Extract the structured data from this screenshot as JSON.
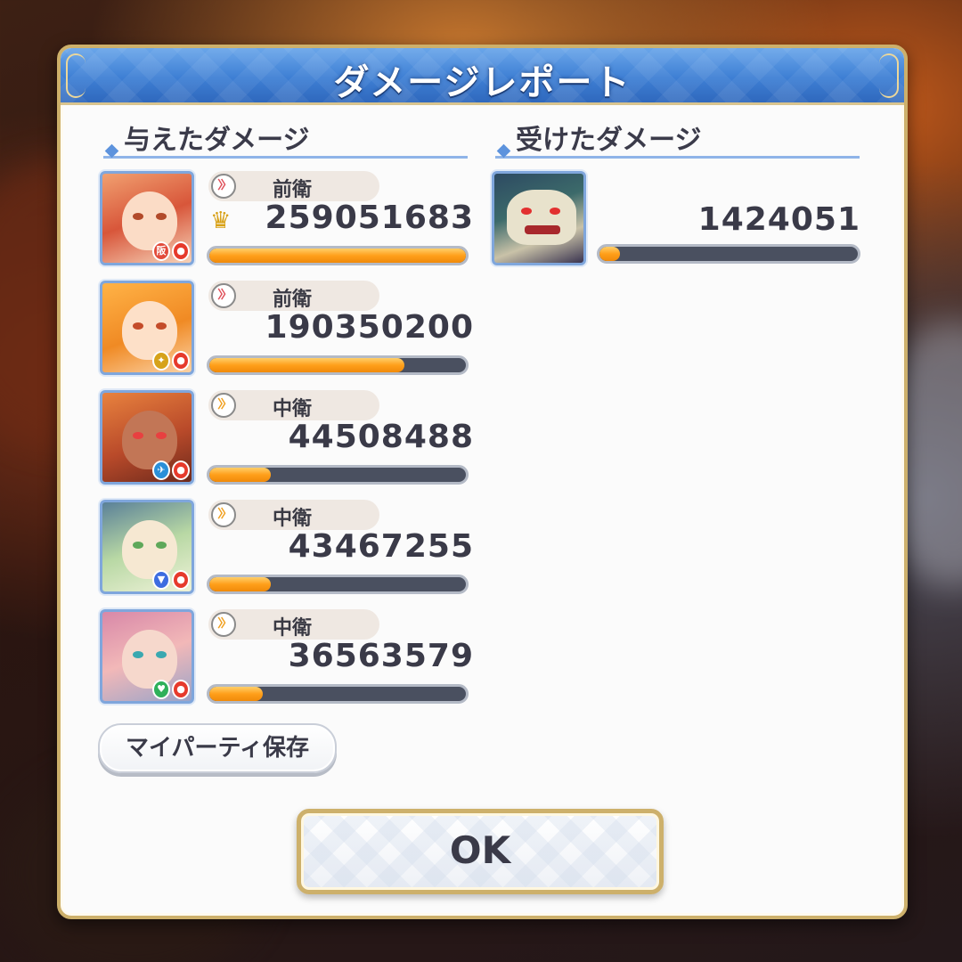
{
  "dialog": {
    "title": "ダメージレポート",
    "ok_label": "OK",
    "save_party_label": "マイパーティ保存"
  },
  "dealt": {
    "header": "与えたダメージ",
    "rows": [
      {
        "role": "前衛",
        "damage": "259051683",
        "bar_fraction": 1.0,
        "top": true,
        "role_arrow_color": "#e0505a",
        "badge_color": "#e24b3b",
        "badge_glyph": "阪"
      },
      {
        "role": "前衛",
        "damage": "190350200",
        "bar_fraction": 0.76,
        "top": false,
        "role_arrow_color": "#e0505a",
        "badge_color": "#d6a21a",
        "badge_glyph": "✦"
      },
      {
        "role": "中衛",
        "damage": "44508488",
        "bar_fraction": 0.24,
        "top": false,
        "role_arrow_color": "#f0a020",
        "badge_color": "#2a8fd8",
        "badge_glyph": "✈"
      },
      {
        "role": "中衛",
        "damage": "43467255",
        "bar_fraction": 0.24,
        "top": false,
        "role_arrow_color": "#f0a020",
        "badge_color": "#3d6de0",
        "badge_glyph": "▼"
      },
      {
        "role": "中衛",
        "damage": "36563579",
        "bar_fraction": 0.21,
        "top": false,
        "role_arrow_color": "#f0a020",
        "badge_color": "#2fb05a",
        "badge_glyph": "♥"
      }
    ]
  },
  "received": {
    "header": "受けたダメージ",
    "rows": [
      {
        "damage": "1424051",
        "bar_fraction": 0.06
      }
    ]
  },
  "icons": {
    "crown": "crown-icon",
    "role_arrow": "role-arrow-icon"
  },
  "colors": {
    "header_blue": "#3e7fd4",
    "frame_gold": "#cdb06b",
    "bar_orange": "#ff9f1a",
    "bar_track": "#4a5060"
  }
}
